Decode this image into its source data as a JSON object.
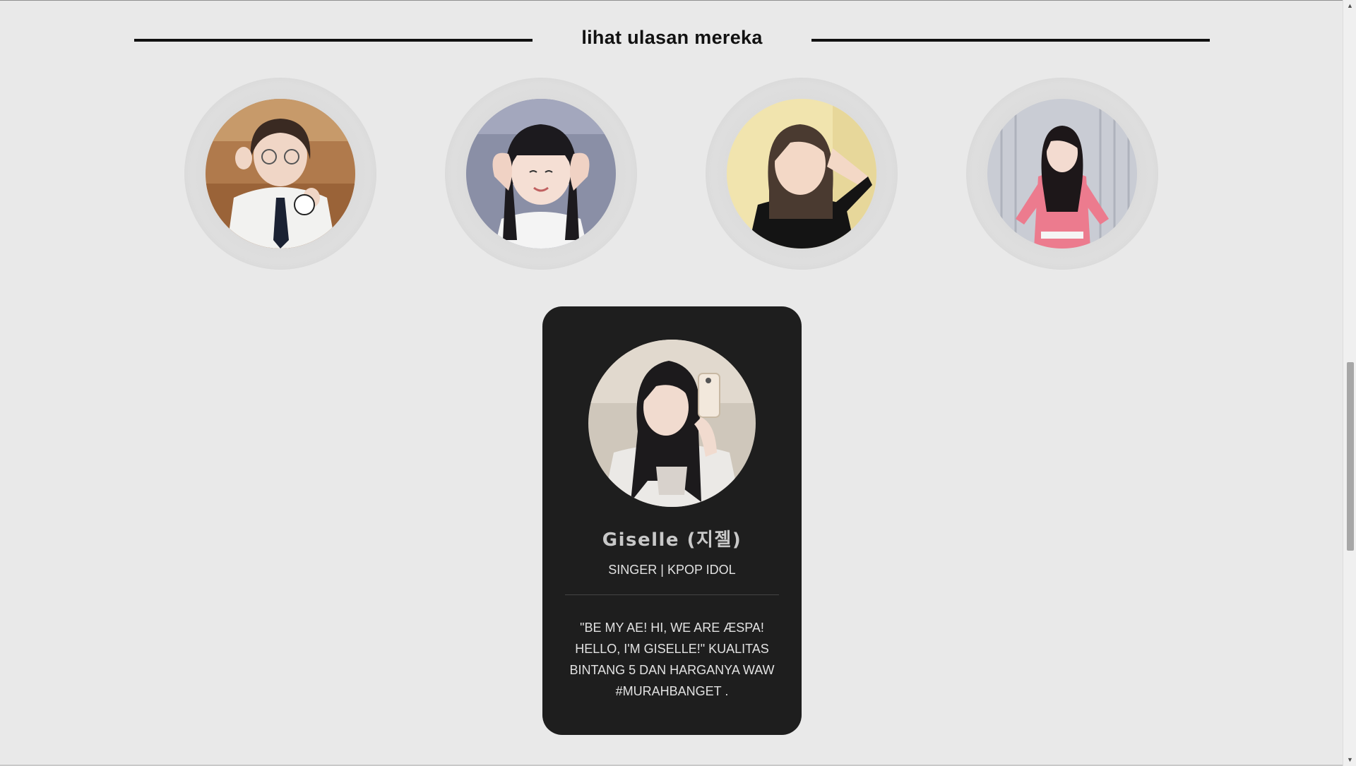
{
  "section": {
    "title": "lihat ulasan mereka"
  },
  "reviewers": [
    {
      "name": "reviewer-1",
      "photo": "avatar-photo-1"
    },
    {
      "name": "reviewer-2",
      "photo": "avatar-photo-2"
    },
    {
      "name": "reviewer-3",
      "photo": "avatar-photo-3"
    },
    {
      "name": "reviewer-4",
      "photo": "avatar-photo-4"
    }
  ],
  "card": {
    "name": "Giselle (지젤)",
    "role": "SINGER | KPOP IDOL",
    "quote": "\"BE MY AE! HI, WE ARE ÆSPA! HELLO, I'M GISELLE!\" KUALITAS BINTANG 5 DAN HARGANYA WAW #MURAHBANGET ."
  },
  "scrollbar": {
    "up_icon": "▲",
    "down_icon": "▼"
  },
  "colors": {
    "background": "#e9e9e9",
    "card": "#1e1e1e",
    "title": "#111111"
  }
}
